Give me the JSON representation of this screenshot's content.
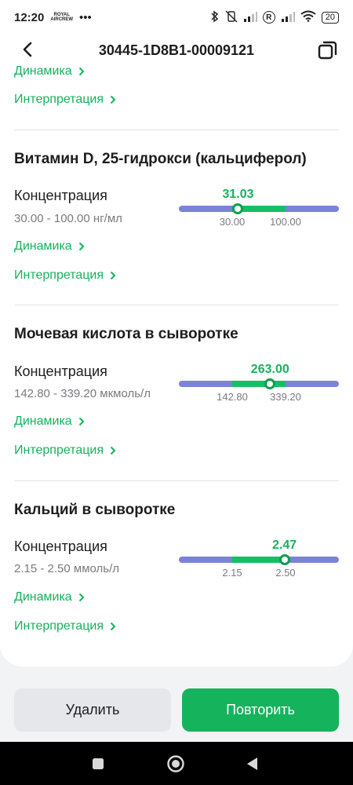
{
  "status_bar": {
    "time": "12:20",
    "carrier_logo": "ROYAL AIRCREW",
    "dots": "•••",
    "right_text": "R",
    "battery": "20"
  },
  "header": {
    "title": "30445-1D8B1-00009121"
  },
  "links": {
    "dynamics": "Динамика",
    "interpretation": "Интерпретация"
  },
  "tests": [
    {
      "title": "Витамин D, 25-гидрокси (кальциферол)",
      "param": "Концентрация",
      "ref_range": "30.00 - 100.00 нг/мл",
      "value": "31.03",
      "low": "30.00",
      "high": "100.00",
      "position_fraction": 0.37
    },
    {
      "title": "Мочевая кислота в сыворотке",
      "param": "Концентрация",
      "ref_range": "142.80 - 339.20 мкмоль/л",
      "value": "263.00",
      "low": "142.80",
      "high": "339.20",
      "position_fraction": 0.57
    },
    {
      "title": "Кальций в сыворотке",
      "param": "Концентрация",
      "ref_range": "2.15 - 2.50 ммоль/л",
      "value": "2.47",
      "low": "2.15",
      "high": "2.50",
      "position_fraction": 0.66
    }
  ],
  "actions": {
    "delete": "Удалить",
    "repeat": "Повторить"
  },
  "colors": {
    "accent": "#14b35c",
    "range_out": "#7b83d6",
    "range_norm": "#14c063"
  },
  "icons": [
    "back-arrow-icon",
    "copy-icon",
    "chevron-right-icon",
    "square-icon",
    "circle-icon",
    "triangle-back-icon"
  ]
}
